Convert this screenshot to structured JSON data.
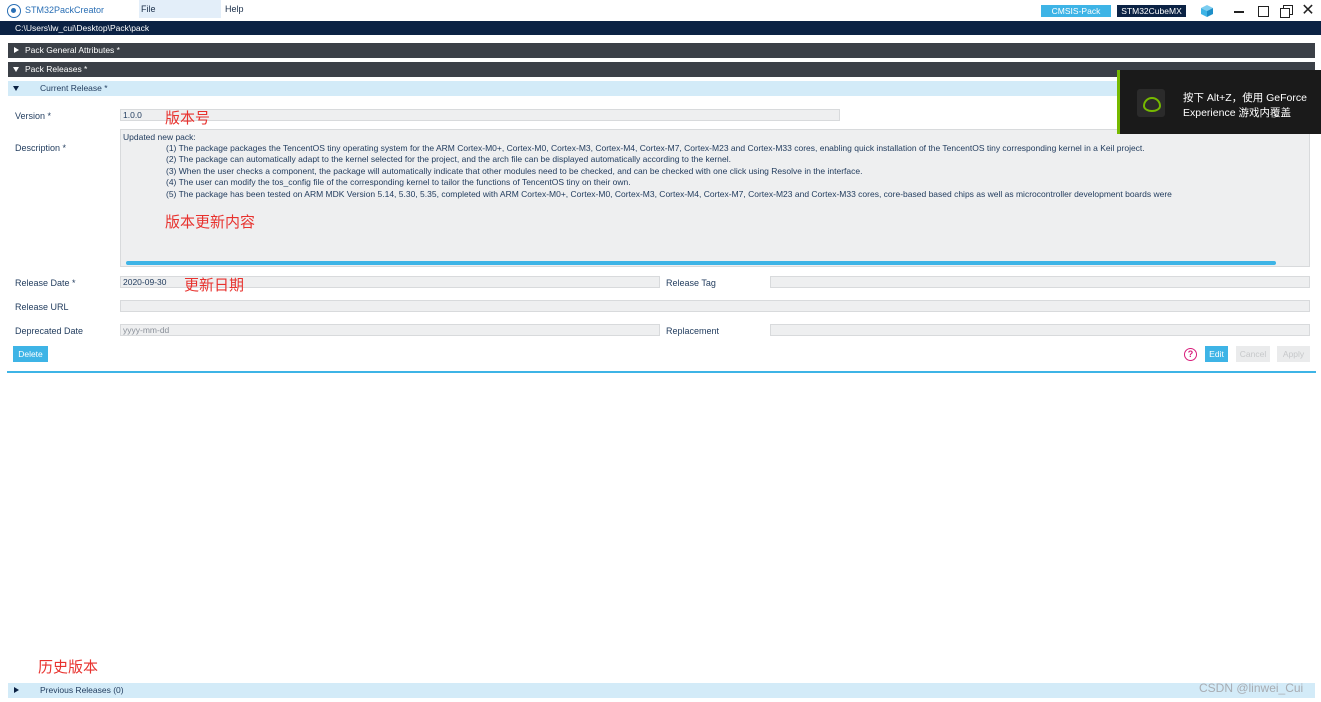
{
  "titlebar": {
    "app_title": "STM32PackCreator",
    "menu": [
      "File",
      "Help"
    ],
    "cmsis_button": "CMSIS-Pack",
    "cubemx_button": "STM32CubeMX",
    "close_glyph": "✕",
    "icons": [
      "app-logo-icon",
      "cube-icon",
      "minimize-icon",
      "restore-icon",
      "maximize-icon",
      "close-icon"
    ]
  },
  "path": "C:\\Users\\lw_cui\\Desktop\\Pack\\pack",
  "sections": {
    "general": "Pack General Attributes *",
    "releases": "Pack Releases *",
    "current": "Current Release *",
    "previous": "Previous Releases (0)"
  },
  "form": {
    "version_label": "Version *",
    "version_value": "1.0.0",
    "description_label": "Description *",
    "description_head": "Updated new pack:",
    "description_lines": [
      "(1) The package packages the TencentOS tiny operating system for the ARM Cortex-M0+, Cortex-M0, Cortex-M3, Cortex-M4, Cortex-M7, Cortex-M23 and Cortex-M33 cores, enabling quick installation of the TencentOS tiny corresponding kernel in a Keil project.",
      "(2) The package can automatically adapt to the kernel selected for the project, and the arch file can be displayed automatically according to the kernel.",
      "(3) When the user checks a component, the package will automatically indicate that other modules need to be checked, and can be checked with one click using Resolve in the interface.",
      "(4) The user can modify the tos_config file of the corresponding kernel to tailor the functions of TencentOS tiny on their own.",
      "(5) The package has been tested on ARM MDK Version 5.14, 5.30, 5.35, completed with ARM Cortex-M0+, Cortex-M0, Cortex-M3, Cortex-M4, Cortex-M7, Cortex-M23 and Cortex-M33 cores, core-based based chips as well as microcontroller development boards were"
    ],
    "release_date_label": "Release Date *",
    "release_date_value": "2020-09-30",
    "release_tag_label": "Release Tag",
    "release_tag_value": "",
    "release_url_label": "Release URL",
    "release_url_value": "",
    "deprecated_date_label": "Deprecated Date",
    "deprecated_date_placeholder": "yyyy-mm-dd",
    "replacement_label": "Replacement",
    "replacement_value": ""
  },
  "buttons": {
    "delete": "Delete",
    "help": "?",
    "edit": "Edit",
    "cancel": "Cancel",
    "apply": "Apply"
  },
  "annotations": {
    "version": "版本号",
    "description": "版本更新内容",
    "release_date": "更新日期",
    "history": "历史版本"
  },
  "overlay": {
    "line1": "按下 Alt+Z，使用 GeForce",
    "line2": "Experience 游戏内覆盖"
  },
  "watermark": "CSDN @linwei_Cui",
  "colors": {
    "accent": "#3eb4e6",
    "navy": "#0b2244",
    "section_dark": "#3b4047",
    "section_light": "#d3ebf8",
    "annotation_red": "#e8322e",
    "help_magenta": "#d81b7a",
    "gfe_green": "#76b900"
  }
}
